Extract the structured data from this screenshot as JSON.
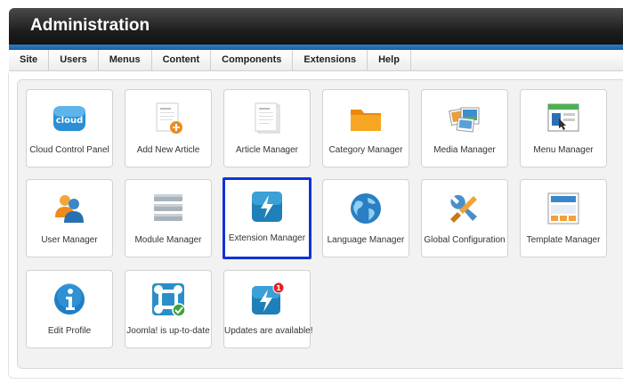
{
  "app": {
    "title": "Administration"
  },
  "menu": [
    "Site",
    "Users",
    "Menus",
    "Content",
    "Components",
    "Extensions",
    "Help"
  ],
  "tiles": [
    {
      "label": "Cloud Control Panel",
      "icon": "cloud-icon"
    },
    {
      "label": "Add New Article",
      "icon": "add-article-icon"
    },
    {
      "label": "Article Manager",
      "icon": "article-icon"
    },
    {
      "label": "Category Manager",
      "icon": "folder-icon"
    },
    {
      "label": "Media Manager",
      "icon": "media-icon"
    },
    {
      "label": "Menu Manager",
      "icon": "menu-window-icon"
    },
    {
      "label": "User Manager",
      "icon": "users-icon"
    },
    {
      "label": "Module Manager",
      "icon": "module-stack-icon"
    },
    {
      "label": "Extension Manager",
      "icon": "extension-bolt-icon",
      "selected": true
    },
    {
      "label": "Language Manager",
      "icon": "globe-icon"
    },
    {
      "label": "Global Configuration",
      "icon": "tools-icon"
    },
    {
      "label": "Template Manager",
      "icon": "template-icon"
    },
    {
      "label": "Edit Profile",
      "icon": "info-icon"
    },
    {
      "label": "Joomla! is up-to-date",
      "icon": "joomla-check-icon"
    },
    {
      "label": "Updates are available!",
      "icon": "update-alert-icon",
      "badge": "1"
    }
  ],
  "colors": {
    "header": "#1c1c1c",
    "accent_bar": "#1b5f9e",
    "selection": "#1232d6"
  }
}
